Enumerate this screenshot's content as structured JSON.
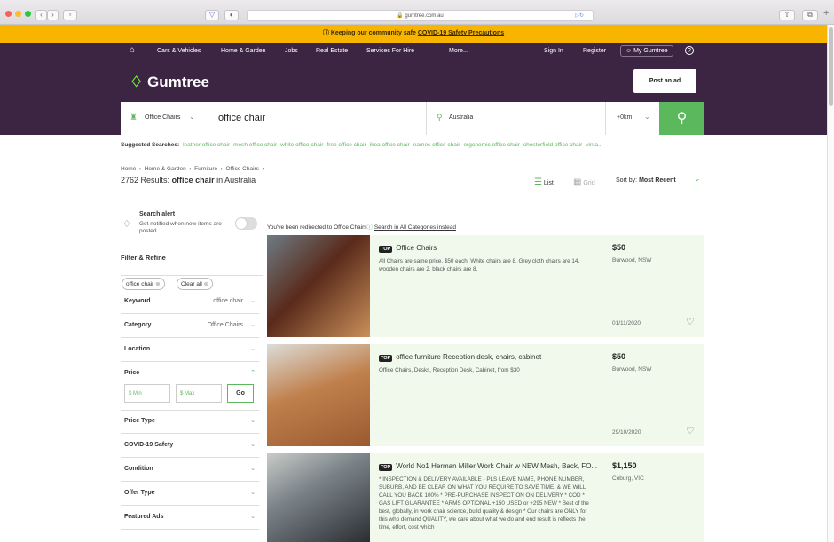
{
  "browser": {
    "url": "gumtree.com.au"
  },
  "notice": {
    "text": "Keeping our community safe",
    "link": "COVID-19 Safety Precautions"
  },
  "topnav": {
    "items": [
      "Cars & Vehicles",
      "Home & Garden",
      "Jobs",
      "Real Estate",
      "Services For Hire",
      "More..."
    ],
    "signin": "Sign In",
    "register": "Register",
    "mygumtree": "My Gumtree"
  },
  "header": {
    "logo": "Gumtree",
    "post_ad": "Post an ad"
  },
  "search": {
    "category": "Office Chairs",
    "query": "office chair",
    "location": "Australia",
    "radius": "+0km"
  },
  "suggested": {
    "label": "Suggested Searches:",
    "items": [
      "leather office chair",
      "mesh office chair",
      "white office chair",
      "free office chair",
      "ikea office chair",
      "eames office chair",
      "ergonomic office chair",
      "chesterfield office chair",
      "vinta..."
    ]
  },
  "breadcrumb": [
    "Home",
    "Home & Garden",
    "Furniture",
    "Office Chairs"
  ],
  "results": {
    "count": "2762 Results:",
    "query": "office chair",
    "suffix": "in Australia"
  },
  "view": {
    "list": "List",
    "grid": "Grid",
    "sort_label": "Sort by:",
    "sort_value": "Most Recent"
  },
  "alert": {
    "title": "Search alert",
    "desc": "Get notified when new items are posted"
  },
  "filter": {
    "title": "Filter & Refine",
    "chips": [
      "office chair",
      "Clear all"
    ],
    "rows": [
      {
        "label": "Keyword",
        "value": "office chair"
      },
      {
        "label": "Category",
        "value": "Office Chairs"
      },
      {
        "label": "Location",
        "value": ""
      },
      {
        "label": "Price",
        "value": ""
      }
    ],
    "price_min": "$ Min",
    "price_max": "$ Max",
    "go": "Go",
    "rows2": [
      {
        "label": "Price Type"
      },
      {
        "label": "COVID-19 Safety"
      },
      {
        "label": "Condition"
      },
      {
        "label": "Offer Type"
      },
      {
        "label": "Featured Ads"
      }
    ]
  },
  "redirect": {
    "text": "You've been redirected to Office Chairs",
    "link": "Search in All Categories instead"
  },
  "listings": [
    {
      "badge": "TOP",
      "title": "Office Chairs",
      "desc": "All Chairs are same price, $50 each. White chairs are 8, Grey cloth chairs are 14, wooden chairs are 2, black chairs are 8.",
      "price": "$50",
      "location": "Burwood, NSW",
      "date": "01/11/2020"
    },
    {
      "badge": "TOP",
      "title": "office furniture Reception desk, chairs, cabinet",
      "desc": "Office Chairs, Desks, Reception Desk, Cabinet, from $30",
      "price": "$50",
      "location": "Burwood, NSW",
      "date": "29/10/2020"
    },
    {
      "badge": "TOP",
      "title": "World No1 Herman Miller Work Chair w NEW Mesh, Back, FO...",
      "desc": "* INSPECTION & DELIVERY AVAILABLE - PLS LEAVE NAME, PHONE NUMBER, SUBURB, AND BE CLEAR ON WHAT YOU REQUIRE TO SAVE TIME, & WE WILL CALL YOU BACK 100% * PRE-PURCHASE INSPECTION ON DELIVERY * COD * GAS LIFT GUARANTEE * ARMS OPTIONAL +150 USED or +295 NEW * Best of the best, globally, in work chair science, build quality & design * Our chairs are ONLY for this who demand QUALITY, we care about what we do and end result is reflects the time, effort, cost which",
      "price": "$1,150",
      "location": "Coburg, VIC",
      "date": ""
    }
  ]
}
